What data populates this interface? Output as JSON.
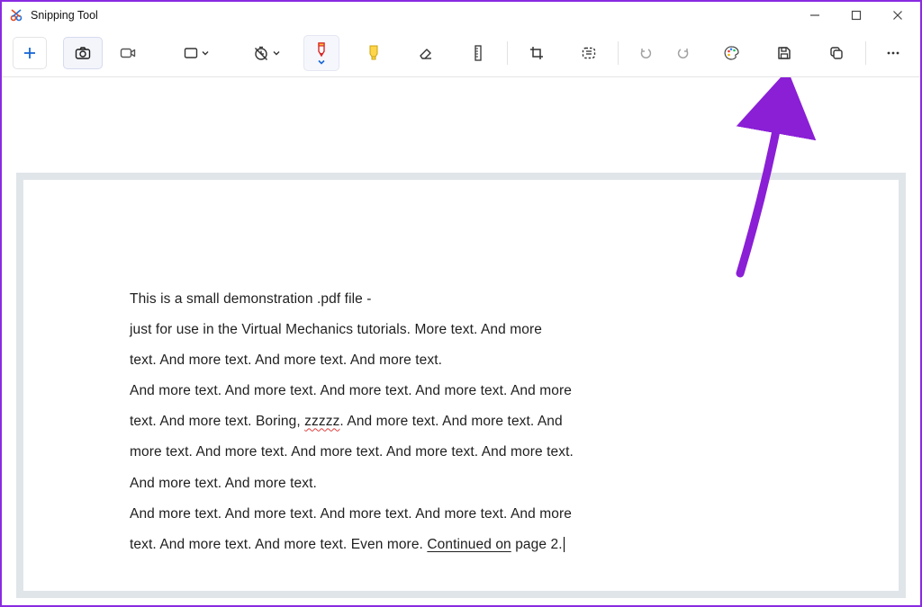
{
  "window": {
    "title": "Snipping Tool"
  },
  "toolbar": {
    "new": "New snip",
    "camera": "Photo mode",
    "video": "Video mode",
    "shape": "Snip shape",
    "delay": "Delay",
    "pen": "Ballpoint pen",
    "highlighter": "Highlighter",
    "eraser": "Eraser",
    "ruler": "Ruler",
    "crop": "Crop",
    "textextract": "Text actions",
    "undo": "Undo",
    "redo": "Redo",
    "paint": "Edit in Paint",
    "save": "Save",
    "copy": "Copy",
    "more": "See more"
  },
  "document": {
    "line1": "This is a small demonstration .pdf file -",
    "line2": "just for use in the Virtual Mechanics tutorials. More text. And more",
    "line3": "text. And more text. And more text. And more text.",
    "line4": "And more text. And more text. And more text. And more text. And more",
    "line5a": "text. And more text. Boring, ",
    "line5err": "zzzzz",
    "line5b": ". And more text. And more text. And",
    "line6": "more text. And more text. And more text. And more text. And more text.",
    "line7": "And more text. And more text.",
    "line8": "And more text. And more text. And more text. And more text. And more",
    "line9a": "text. And more text. And more text. Even more. ",
    "line9link": "Continued on",
    "line9b": " page 2."
  },
  "annotation": {
    "points_to": "save-button"
  }
}
